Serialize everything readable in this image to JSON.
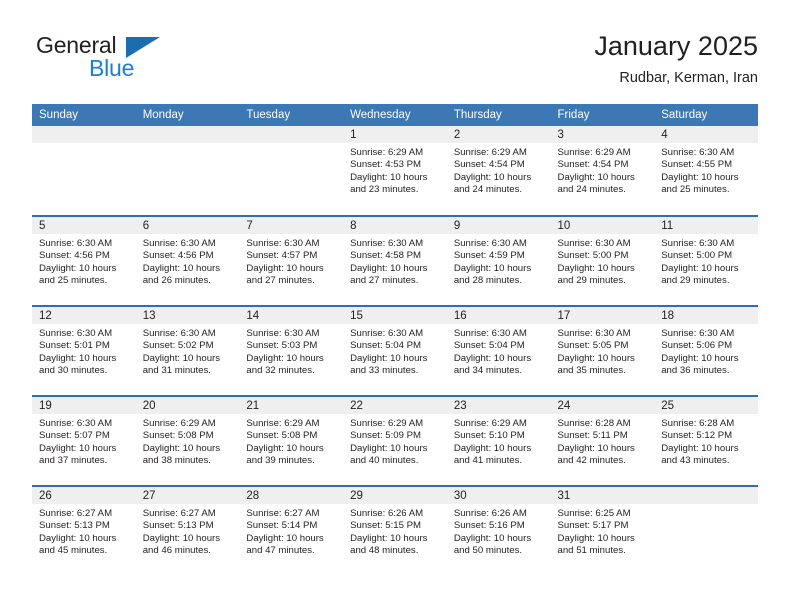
{
  "brand": {
    "name_part1": "General",
    "name_part2": "Blue",
    "triangle_icon": "triangle-icon",
    "colors": {
      "general_text": "#231f20",
      "blue_text": "#1b7fd4",
      "triangle": "#1b6cb0"
    }
  },
  "header": {
    "title": "January 2025",
    "subtitle": "Rudbar, Kerman, Iran"
  },
  "theme": {
    "header_blue": "#3b78b4",
    "separator_blue": "#2f6fad",
    "band_gray": "#efefef",
    "text": "#231f20"
  },
  "calendar": {
    "weekday_headers": [
      "Sunday",
      "Monday",
      "Tuesday",
      "Wednesday",
      "Thursday",
      "Friday",
      "Saturday"
    ],
    "weeks": [
      [
        {
          "day": "",
          "sunrise": "",
          "sunset": "",
          "daylight": "",
          "empty": true
        },
        {
          "day": "",
          "sunrise": "",
          "sunset": "",
          "daylight": "",
          "empty": true
        },
        {
          "day": "",
          "sunrise": "",
          "sunset": "",
          "daylight": "",
          "empty": true
        },
        {
          "day": "1",
          "sunrise": "Sunrise: 6:29 AM",
          "sunset": "Sunset: 4:53 PM",
          "daylight": "Daylight: 10 hours and 23 minutes.",
          "empty": false
        },
        {
          "day": "2",
          "sunrise": "Sunrise: 6:29 AM",
          "sunset": "Sunset: 4:54 PM",
          "daylight": "Daylight: 10 hours and 24 minutes.",
          "empty": false
        },
        {
          "day": "3",
          "sunrise": "Sunrise: 6:29 AM",
          "sunset": "Sunset: 4:54 PM",
          "daylight": "Daylight: 10 hours and 24 minutes.",
          "empty": false
        },
        {
          "day": "4",
          "sunrise": "Sunrise: 6:30 AM",
          "sunset": "Sunset: 4:55 PM",
          "daylight": "Daylight: 10 hours and 25 minutes.",
          "empty": false
        }
      ],
      [
        {
          "day": "5",
          "sunrise": "Sunrise: 6:30 AM",
          "sunset": "Sunset: 4:56 PM",
          "daylight": "Daylight: 10 hours and 25 minutes.",
          "empty": false
        },
        {
          "day": "6",
          "sunrise": "Sunrise: 6:30 AM",
          "sunset": "Sunset: 4:56 PM",
          "daylight": "Daylight: 10 hours and 26 minutes.",
          "empty": false
        },
        {
          "day": "7",
          "sunrise": "Sunrise: 6:30 AM",
          "sunset": "Sunset: 4:57 PM",
          "daylight": "Daylight: 10 hours and 27 minutes.",
          "empty": false
        },
        {
          "day": "8",
          "sunrise": "Sunrise: 6:30 AM",
          "sunset": "Sunset: 4:58 PM",
          "daylight": "Daylight: 10 hours and 27 minutes.",
          "empty": false
        },
        {
          "day": "9",
          "sunrise": "Sunrise: 6:30 AM",
          "sunset": "Sunset: 4:59 PM",
          "daylight": "Daylight: 10 hours and 28 minutes.",
          "empty": false
        },
        {
          "day": "10",
          "sunrise": "Sunrise: 6:30 AM",
          "sunset": "Sunset: 5:00 PM",
          "daylight": "Daylight: 10 hours and 29 minutes.",
          "empty": false
        },
        {
          "day": "11",
          "sunrise": "Sunrise: 6:30 AM",
          "sunset": "Sunset: 5:00 PM",
          "daylight": "Daylight: 10 hours and 29 minutes.",
          "empty": false
        }
      ],
      [
        {
          "day": "12",
          "sunrise": "Sunrise: 6:30 AM",
          "sunset": "Sunset: 5:01 PM",
          "daylight": "Daylight: 10 hours and 30 minutes.",
          "empty": false
        },
        {
          "day": "13",
          "sunrise": "Sunrise: 6:30 AM",
          "sunset": "Sunset: 5:02 PM",
          "daylight": "Daylight: 10 hours and 31 minutes.",
          "empty": false
        },
        {
          "day": "14",
          "sunrise": "Sunrise: 6:30 AM",
          "sunset": "Sunset: 5:03 PM",
          "daylight": "Daylight: 10 hours and 32 minutes.",
          "empty": false
        },
        {
          "day": "15",
          "sunrise": "Sunrise: 6:30 AM",
          "sunset": "Sunset: 5:04 PM",
          "daylight": "Daylight: 10 hours and 33 minutes.",
          "empty": false
        },
        {
          "day": "16",
          "sunrise": "Sunrise: 6:30 AM",
          "sunset": "Sunset: 5:04 PM",
          "daylight": "Daylight: 10 hours and 34 minutes.",
          "empty": false
        },
        {
          "day": "17",
          "sunrise": "Sunrise: 6:30 AM",
          "sunset": "Sunset: 5:05 PM",
          "daylight": "Daylight: 10 hours and 35 minutes.",
          "empty": false
        },
        {
          "day": "18",
          "sunrise": "Sunrise: 6:30 AM",
          "sunset": "Sunset: 5:06 PM",
          "daylight": "Daylight: 10 hours and 36 minutes.",
          "empty": false
        }
      ],
      [
        {
          "day": "19",
          "sunrise": "Sunrise: 6:30 AM",
          "sunset": "Sunset: 5:07 PM",
          "daylight": "Daylight: 10 hours and 37 minutes.",
          "empty": false
        },
        {
          "day": "20",
          "sunrise": "Sunrise: 6:29 AM",
          "sunset": "Sunset: 5:08 PM",
          "daylight": "Daylight: 10 hours and 38 minutes.",
          "empty": false
        },
        {
          "day": "21",
          "sunrise": "Sunrise: 6:29 AM",
          "sunset": "Sunset: 5:08 PM",
          "daylight": "Daylight: 10 hours and 39 minutes.",
          "empty": false
        },
        {
          "day": "22",
          "sunrise": "Sunrise: 6:29 AM",
          "sunset": "Sunset: 5:09 PM",
          "daylight": "Daylight: 10 hours and 40 minutes.",
          "empty": false
        },
        {
          "day": "23",
          "sunrise": "Sunrise: 6:29 AM",
          "sunset": "Sunset: 5:10 PM",
          "daylight": "Daylight: 10 hours and 41 minutes.",
          "empty": false
        },
        {
          "day": "24",
          "sunrise": "Sunrise: 6:28 AM",
          "sunset": "Sunset: 5:11 PM",
          "daylight": "Daylight: 10 hours and 42 minutes.",
          "empty": false
        },
        {
          "day": "25",
          "sunrise": "Sunrise: 6:28 AM",
          "sunset": "Sunset: 5:12 PM",
          "daylight": "Daylight: 10 hours and 43 minutes.",
          "empty": false
        }
      ],
      [
        {
          "day": "26",
          "sunrise": "Sunrise: 6:27 AM",
          "sunset": "Sunset: 5:13 PM",
          "daylight": "Daylight: 10 hours and 45 minutes.",
          "empty": false
        },
        {
          "day": "27",
          "sunrise": "Sunrise: 6:27 AM",
          "sunset": "Sunset: 5:13 PM",
          "daylight": "Daylight: 10 hours and 46 minutes.",
          "empty": false
        },
        {
          "day": "28",
          "sunrise": "Sunrise: 6:27 AM",
          "sunset": "Sunset: 5:14 PM",
          "daylight": "Daylight: 10 hours and 47 minutes.",
          "empty": false
        },
        {
          "day": "29",
          "sunrise": "Sunrise: 6:26 AM",
          "sunset": "Sunset: 5:15 PM",
          "daylight": "Daylight: 10 hours and 48 minutes.",
          "empty": false
        },
        {
          "day": "30",
          "sunrise": "Sunrise: 6:26 AM",
          "sunset": "Sunset: 5:16 PM",
          "daylight": "Daylight: 10 hours and 50 minutes.",
          "empty": false
        },
        {
          "day": "31",
          "sunrise": "Sunrise: 6:25 AM",
          "sunset": "Sunset: 5:17 PM",
          "daylight": "Daylight: 10 hours and 51 minutes.",
          "empty": false
        },
        {
          "day": "",
          "sunrise": "",
          "sunset": "",
          "daylight": "",
          "empty": true
        }
      ]
    ]
  }
}
